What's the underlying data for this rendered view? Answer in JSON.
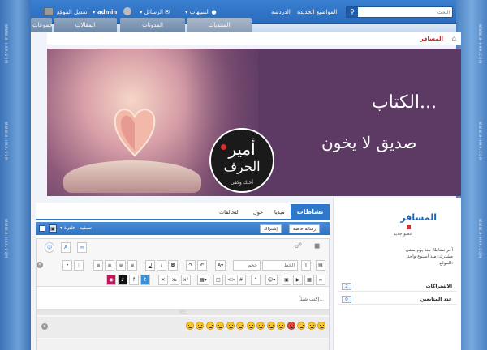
{
  "topbar": {
    "search_placeholder": "البحث",
    "links": [
      "المواضيع الجديدة",
      "الدردشة"
    ],
    "notifications_label": "التنبيهات",
    "messages_label": "الرسائل",
    "username": "admin",
    "edit_location": "تعديل الموقع:"
  },
  "nav_tabs": [
    "المنتديات",
    "المدونات",
    "المقالات",
    "المجموعات"
  ],
  "breadcrumb": {
    "current": "المسافر"
  },
  "cover": {
    "title_line1": "الكتاب...",
    "title_line2": "صديق لا يخون",
    "logo_line1": "أمير",
    "logo_line2": "الحرف",
    "logo_tagline": "أحبك وكفى"
  },
  "profile": {
    "name": "المسافر",
    "rank": "عضو جديد",
    "last_activity": "آخر نشاطا: منذ يوم مضى",
    "joined": "مشترك: منذ أسبوع واحد",
    "location_label": "الموقع:",
    "stats": [
      {
        "label": "الاشتراكات",
        "value": "2"
      },
      {
        "label": "عدد المتابعين",
        "value": "0"
      }
    ]
  },
  "activity": {
    "tabs": [
      "نشاطات",
      "ميديا",
      "حول",
      "التحالفات"
    ],
    "send_message": "رسالة خاصة",
    "subscribe": "إشتراك",
    "filter_label": "تصفية - فلترة",
    "composer": {
      "placeholder": "إكتب شيئاً...",
      "font_label": "الخط",
      "size_label": "حجم",
      "smiley_count": 14
    }
  },
  "side_watermark": "WWW.A-HAR.COM"
}
